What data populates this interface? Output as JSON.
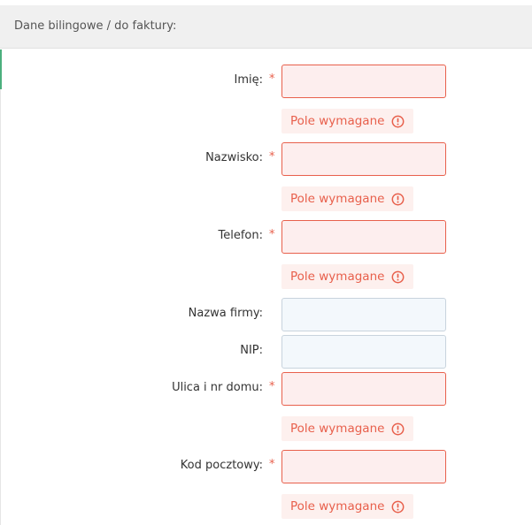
{
  "section": {
    "title": "Dane bilingowe / do faktury:"
  },
  "form": {
    "required_marker": "*",
    "error_message": "Pole wymagane",
    "fields": [
      {
        "label": "Imię:",
        "value": "",
        "required": true,
        "error": "Pole wymagane"
      },
      {
        "label": "Nazwisko:",
        "value": "",
        "required": true,
        "error": "Pole wymagane"
      },
      {
        "label": "Telefon:",
        "value": "",
        "required": true,
        "error": "Pole wymagane"
      },
      {
        "label": "Nazwa firmy:",
        "value": "",
        "required": false
      },
      {
        "label": "NIP:",
        "value": "",
        "required": false
      },
      {
        "label": "Ulica i nr domu:",
        "value": "",
        "required": true,
        "error": "Pole wymagane"
      },
      {
        "label": "Kod pocztowy:",
        "value": "",
        "required": true,
        "error": "Pole wymagane"
      }
    ]
  },
  "colors": {
    "error": "#e8604c",
    "error_bg": "#fdeeee",
    "header_bg": "#f0f0f0",
    "valid_field_bg": "#f3f8fc",
    "accent": "#4caf7d"
  },
  "icons": {
    "error": "exclamation-circle-icon"
  }
}
